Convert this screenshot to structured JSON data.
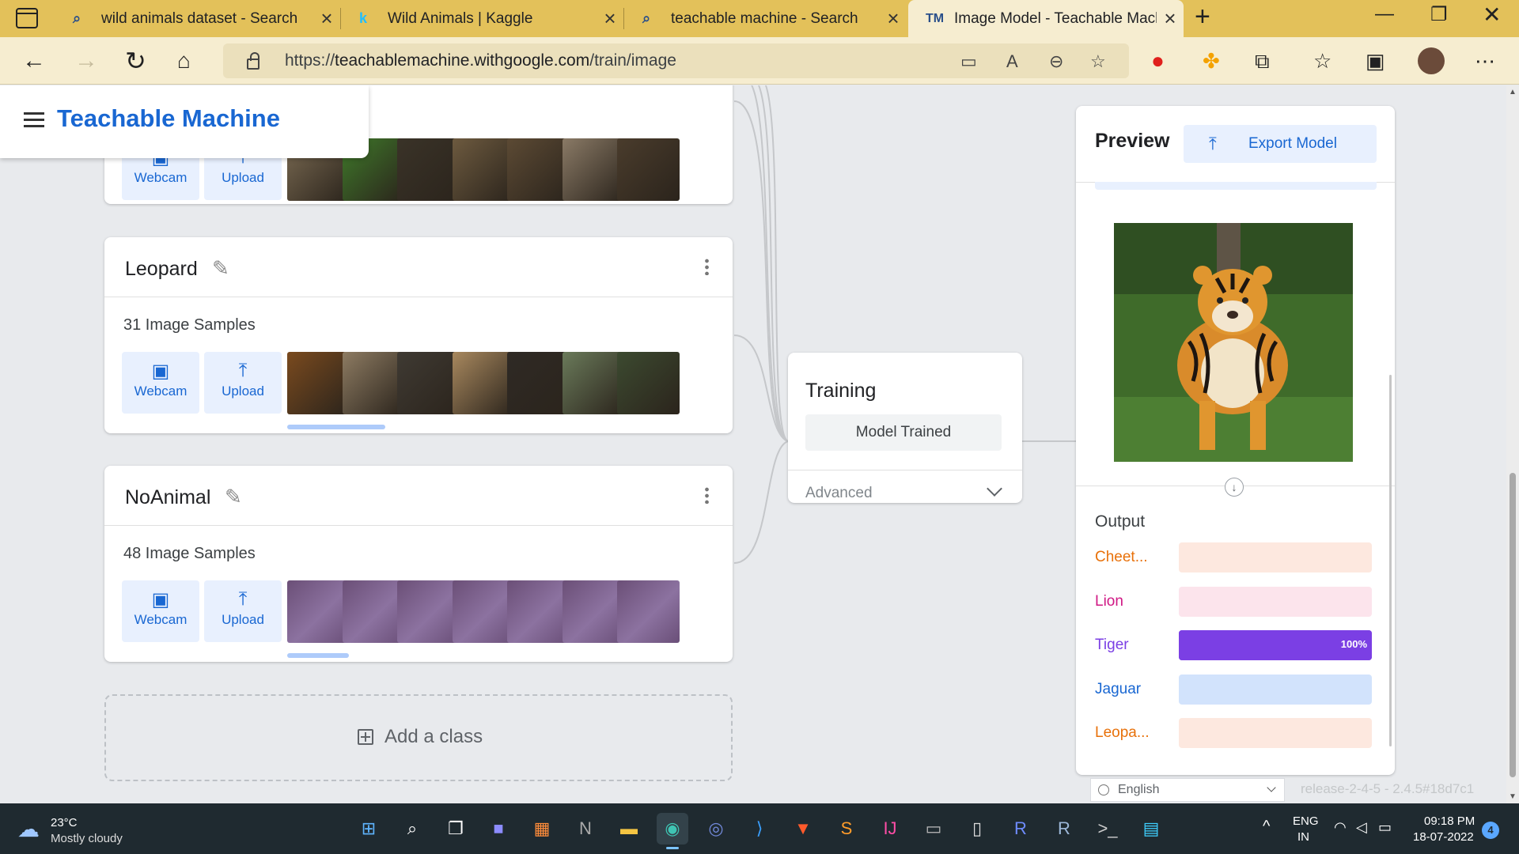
{
  "browser": {
    "tabs": [
      {
        "title": "wild animals dataset - Search",
        "icon": "search-icon"
      },
      {
        "title": "Wild Animals | Kaggle",
        "icon": "kaggle-icon"
      },
      {
        "title": "teachable machine - Search",
        "icon": "search-icon"
      },
      {
        "title": "Image Model - Teachable Machin",
        "icon": "teachable-machine-icon",
        "active": true
      }
    ],
    "url_prefix": "https://",
    "url_host": "teachablemachine.withgoogle.com",
    "url_path": "/train/image"
  },
  "app": {
    "name": "Teachable Machine",
    "brand_color": "#1967d2"
  },
  "classes": [
    {
      "name": "",
      "webcam_label": "Webcam",
      "upload_label": "Upload",
      "thumbs": [
        "#7a6a52",
        "#3f7a2a",
        "#3a3328",
        "#6d5a3f",
        "#5c4a34",
        "#8a7a66",
        "#4a3c2c"
      ]
    },
    {
      "name": "Leopard",
      "samples": "31 Image Samples",
      "webcam_label": "Webcam",
      "upload_label": "Upload",
      "thumbs": [
        "#7a4a1e",
        "#8d7b62",
        "#3f3a33",
        "#a8885e",
        "#2f2a25",
        "#6a7a5a",
        "#3c4a30"
      ]
    },
    {
      "name": "NoAnimal",
      "samples": "48 Image Samples",
      "webcam_label": "Webcam",
      "upload_label": "Upload",
      "thumbs": [
        "#7b5e85",
        "#7b5e85",
        "#7b5e85",
        "#7b5e85",
        "#7b5e85",
        "#7b5e85",
        "#7b5e85"
      ]
    }
  ],
  "add_class_label": "Add a class",
  "training": {
    "title": "Training",
    "button": "Model Trained",
    "advanced": "Advanced"
  },
  "preview": {
    "title": "Preview",
    "export_label": "Export Model",
    "output_title": "Output",
    "outputs": [
      {
        "label": "Cheet...",
        "color": "#e8710a",
        "track": "#fde8df",
        "value": 0
      },
      {
        "label": "Lion",
        "color": "#d01884",
        "track": "#fce4ec",
        "value": 0
      },
      {
        "label": "Tiger",
        "color": "#7b3fe4",
        "track": "#7b3fe4",
        "value": 1.0,
        "pct": "100%"
      },
      {
        "label": "Jaguar",
        "color": "#1967d2",
        "track": "#d2e3fc",
        "value": 0
      },
      {
        "label": "Leopa...",
        "color": "#e8710a",
        "track": "#fde8df",
        "value": 0
      }
    ]
  },
  "footer": {
    "language": "English",
    "release": "release-2-4-5 - 2.4.5#18d7c1"
  },
  "taskbar": {
    "weather_temp": "23°C",
    "weather_desc": "Mostly cloudy",
    "lang_line1": "ENG",
    "lang_line2": "IN",
    "time": "09:18 PM",
    "date": "18-07-2022",
    "notifications": "4"
  }
}
